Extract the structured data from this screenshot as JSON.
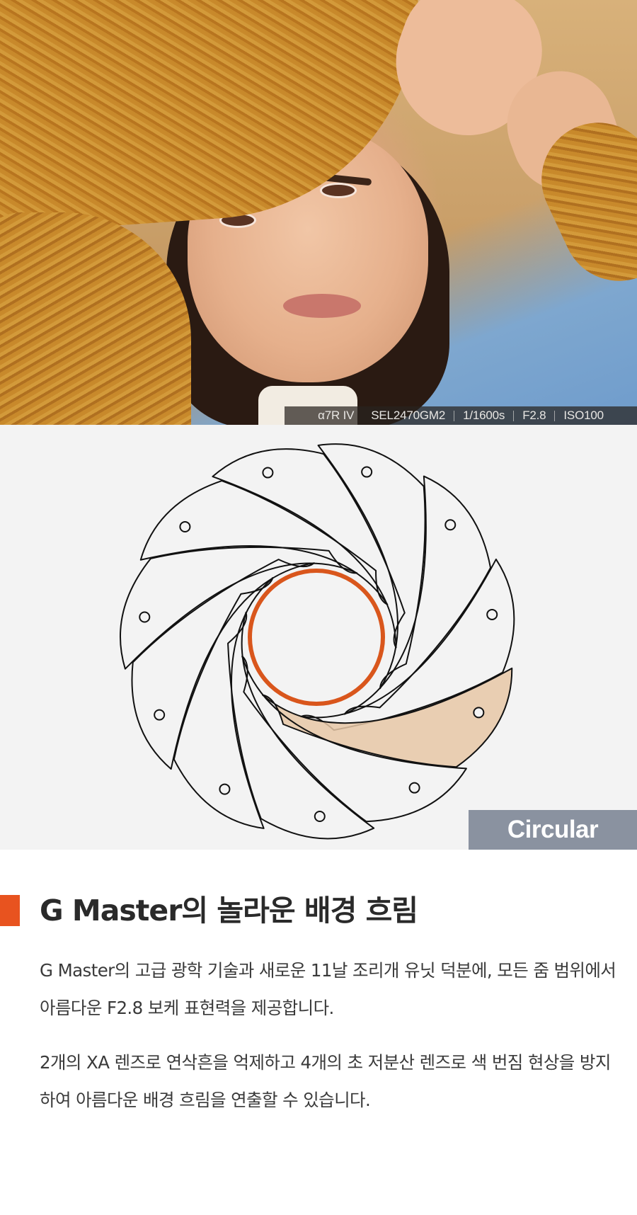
{
  "hero_photo": {
    "exif": {
      "camera": "α7R IV",
      "lens": "SEL2470GM2",
      "shutter": "1/1600s",
      "aperture": "F2.8",
      "iso": "ISO100"
    }
  },
  "aperture_diagram": {
    "blade_count": 11,
    "highlighted_blade_color": "#e6c7a6",
    "opening_color": "#d9561c",
    "label": "Circular"
  },
  "section": {
    "accent_color": "#e8531f",
    "title": "G Master의 놀라운 배경 흐림",
    "paragraphs": [
      "G Master의 고급 광학 기술과 새로운 11날 조리개 유닛 덕분에, 모든 줌 범위에서 아름다운 F2.8 보케 표현력을 제공합니다.",
      "2개의 XA 렌즈로 연삭흔을 억제하고 4개의 초 저분산 렌즈로 색 번짐 현상을 방지하여 아름다운 배경 흐림을 연출할 수 있습니다."
    ]
  }
}
